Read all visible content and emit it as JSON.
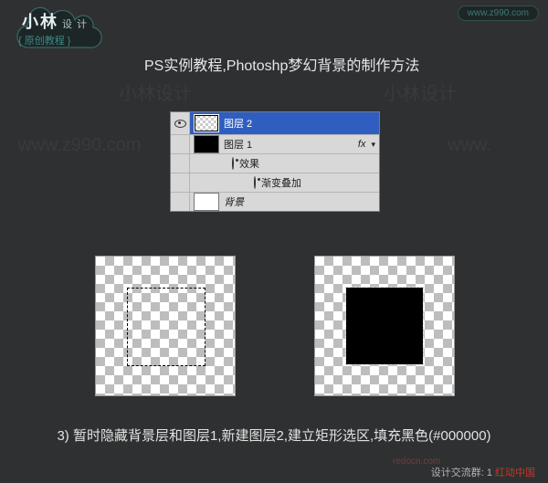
{
  "logo": {
    "main": "小林",
    "sub_small": "设 计",
    "bracket": "{ 原创教程 }"
  },
  "site_url": "www.z990.com",
  "heading": "PS实例教程,Photoshp梦幻背景的制作方法",
  "layers": {
    "row1": "图层 2",
    "row2": "图层 1",
    "row2_fx": "fx",
    "row3": "效果",
    "row4": "渐变叠加",
    "row5": "背景"
  },
  "caption": "3) 暂时隐藏背景层和图层1,新建图层2,建立矩形选区,填充黑色(#000000)",
  "footer": {
    "prefix": "设计交流群: 1",
    "red": "红动中国"
  },
  "watermarks": {
    "w1": "小林设计",
    "w2": "小林设计",
    "w3": "www.z990.com",
    "w4": "www.",
    "redocn": "redocn.com"
  }
}
